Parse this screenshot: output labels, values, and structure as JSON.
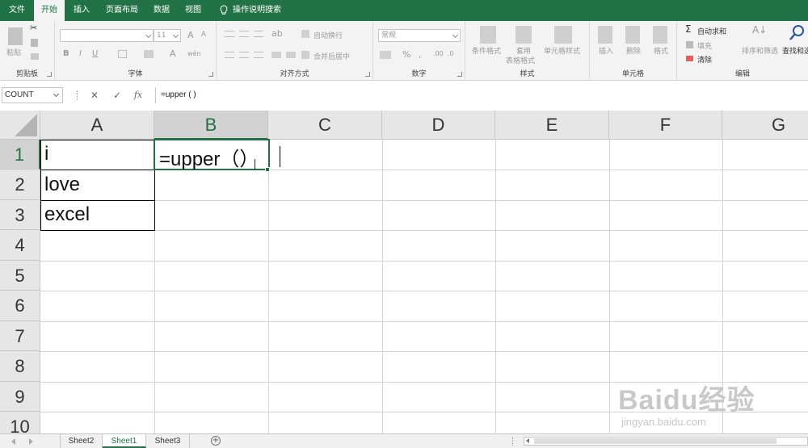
{
  "ribbon_tabs": [
    "文件",
    "开始",
    "插入",
    "页面布局",
    "数据",
    "视图",
    "操作说明搜索"
  ],
  "active_tab": "开始",
  "ribbon": {
    "clipboard": {
      "label": "剪贴板",
      "paste": "粘贴"
    },
    "font": {
      "label": "字体",
      "size": "11",
      "bold": "B",
      "italic": "I",
      "underline": "U"
    },
    "alignment": {
      "label": "对齐方式",
      "wrap": "自动换行",
      "merge": "合并后居中"
    },
    "number": {
      "label": "数字",
      "format": "常规",
      "percent": "%"
    },
    "styles": {
      "label": "样式",
      "conditional": "条件格式",
      "table1": "套用",
      "table2": "表格格式",
      "cell_styles": "单元格样式"
    },
    "cells": {
      "label": "单元格",
      "insert": "插入",
      "delete": "删除",
      "format": "格式"
    },
    "editing": {
      "label": "编辑",
      "autosum": "自动求和",
      "fill": "填充",
      "clear": "清除",
      "sort": "排序和筛选",
      "find": "查找和选"
    }
  },
  "formula_bar": {
    "name_box": "COUNT",
    "cancel": "✕",
    "enter": "✓",
    "fx": "fx",
    "content": "=upper ( )"
  },
  "columns": [
    "A",
    "B",
    "C",
    "D",
    "E",
    "F",
    "G"
  ],
  "rows": [
    "1",
    "2",
    "3",
    "4",
    "5",
    "6",
    "7",
    "8",
    "9",
    "10"
  ],
  "cells": {
    "A1": "i",
    "A2": "love",
    "A3": "excel",
    "B1": "=upper（）"
  },
  "sheets": [
    "Sheet2",
    "Sheet1",
    "Sheet3"
  ],
  "active_sheet": "Sheet1",
  "watermark": {
    "brand": "Baidu经验",
    "url": "jingyan.baidu.com"
  },
  "colors": {
    "accent": "#217346",
    "header_bg": "#e6e6e6",
    "selected_header_bg": "#d2d2d2"
  }
}
